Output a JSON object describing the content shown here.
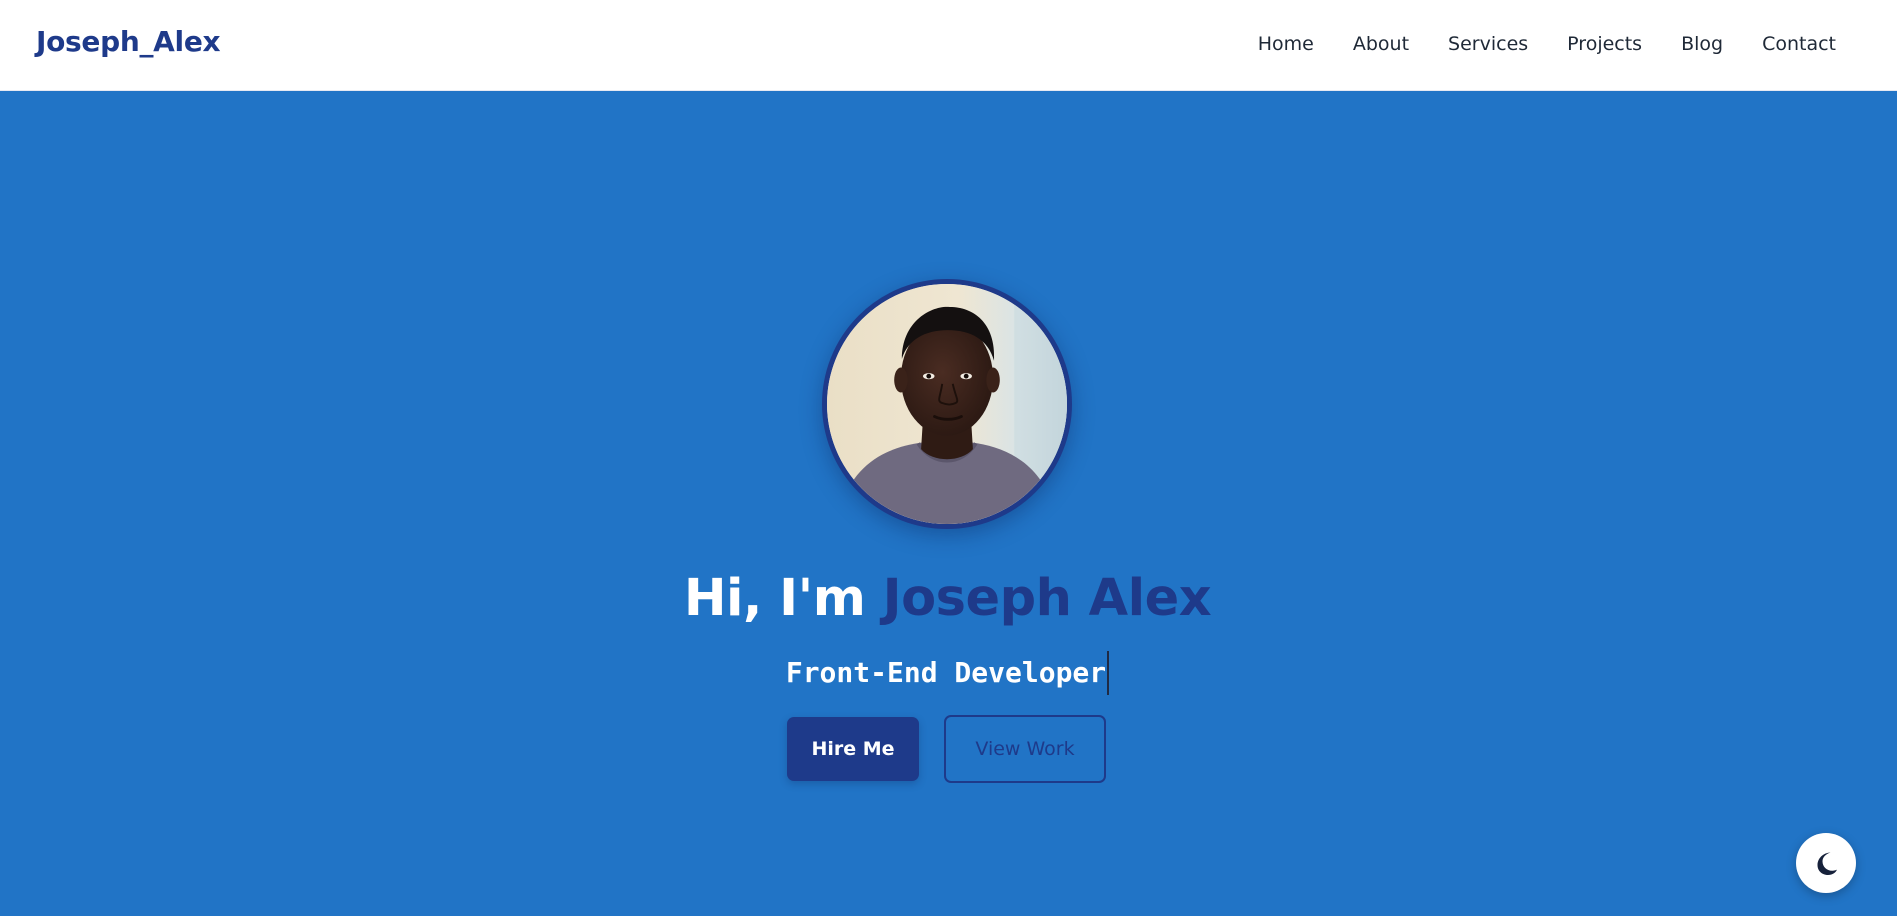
{
  "brand": {
    "name": "Joseph_Alex"
  },
  "nav": {
    "items": [
      {
        "label": "Home"
      },
      {
        "label": "About"
      },
      {
        "label": "Services"
      },
      {
        "label": "Projects"
      },
      {
        "label": "Blog"
      },
      {
        "label": "Contact"
      }
    ]
  },
  "hero": {
    "avatar_alt": "profile-photo",
    "greeting_prefix": "Hi, I'm ",
    "greeting_name": "Joseph Alex",
    "role": "Front-End Developer",
    "primary_button": "Hire Me",
    "secondary_button": "View Work"
  },
  "theme_toggle": {
    "icon": "moon-icon"
  },
  "colors": {
    "brand": "#1e3a8a",
    "hero_background": "#2174c6",
    "navbar_background": "#ffffff",
    "nav_text": "#1f2937",
    "toggle_background": "#ffffff"
  }
}
